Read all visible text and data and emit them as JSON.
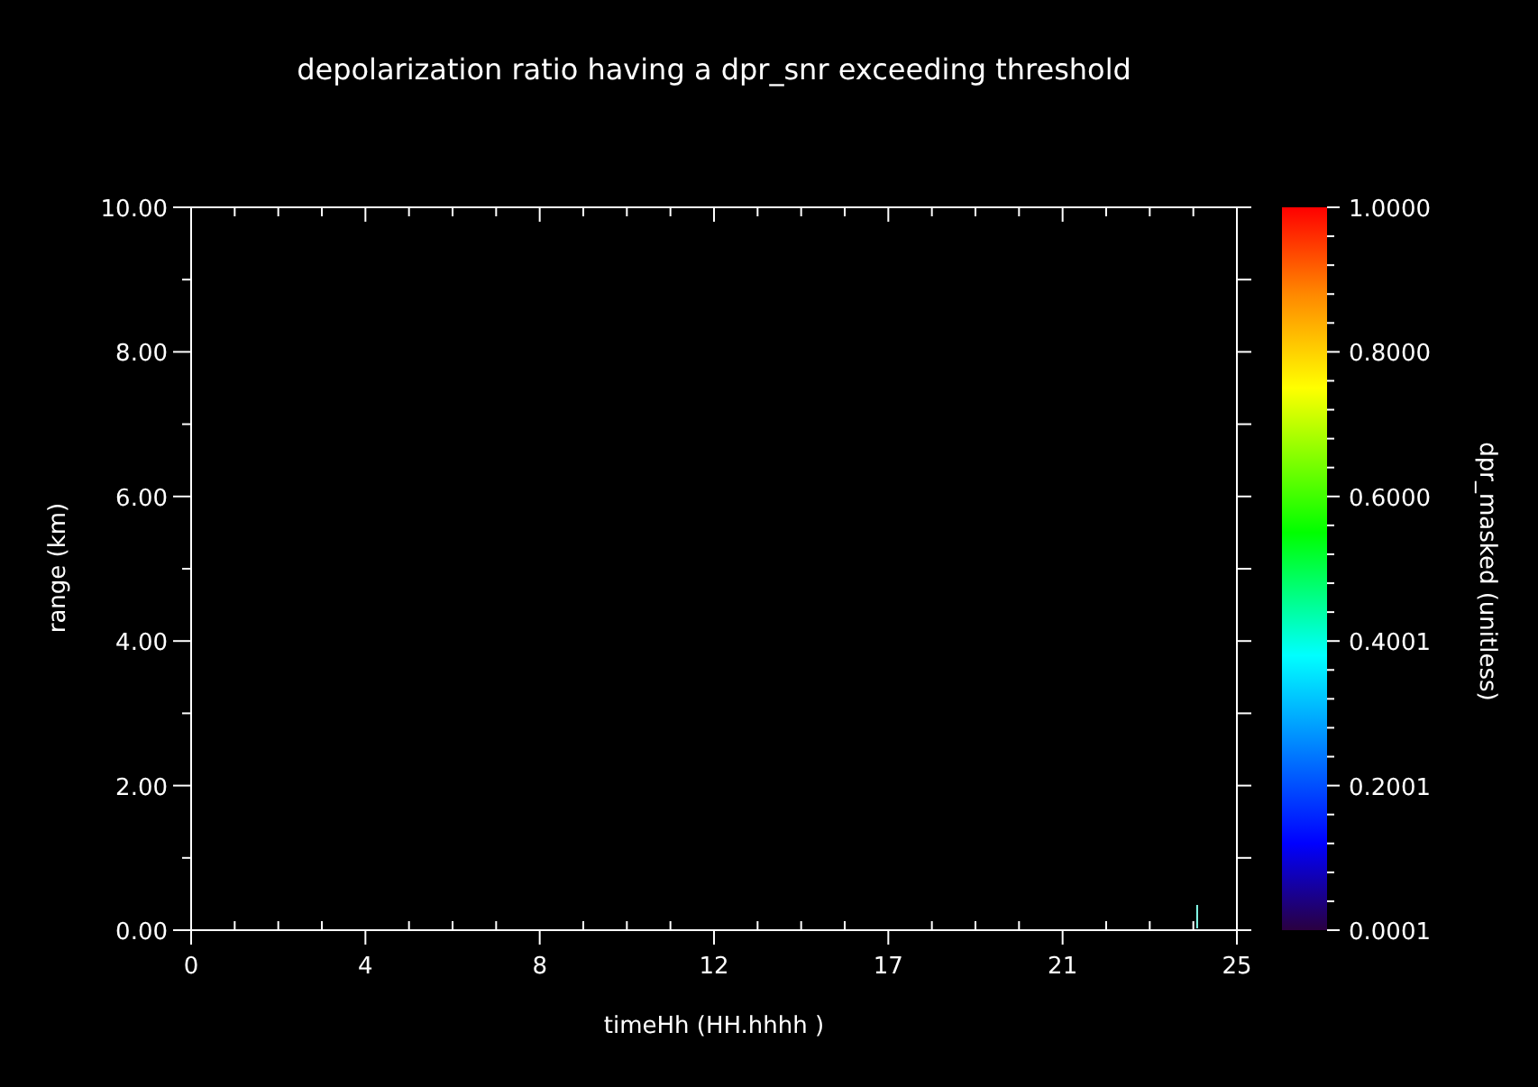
{
  "chart_data": {
    "type": "scatter",
    "title": "depolarization ratio having a dpr_snr exceeding threshold",
    "xlabel": "timeHh (HH.hhhh )",
    "ylabel": "range (km)",
    "xlim": [
      0,
      25
    ],
    "ylim": [
      0,
      10
    ],
    "xticks": [
      {
        "value": 0,
        "label": "0"
      },
      {
        "value": 4.1667,
        "label": "4"
      },
      {
        "value": 8.3333,
        "label": "8"
      },
      {
        "value": 12.5,
        "label": "12"
      },
      {
        "value": 16.6667,
        "label": "17"
      },
      {
        "value": 20.8333,
        "label": "21"
      },
      {
        "value": 25,
        "label": "25"
      }
    ],
    "yticks": [
      {
        "value": 0,
        "label": "0.00"
      },
      {
        "value": 2,
        "label": "2.00"
      },
      {
        "value": 4,
        "label": "4.00"
      },
      {
        "value": 6,
        "label": "6.00"
      },
      {
        "value": 8,
        "label": "8.00"
      },
      {
        "value": 10,
        "label": "10.00"
      }
    ]
  },
  "colorbar": {
    "label": "dpr_masked (unitless)",
    "ticks": [
      "1.0000",
      "0.8000",
      "0.6000",
      "0.4001",
      "0.2001",
      "0.0001"
    ]
  }
}
